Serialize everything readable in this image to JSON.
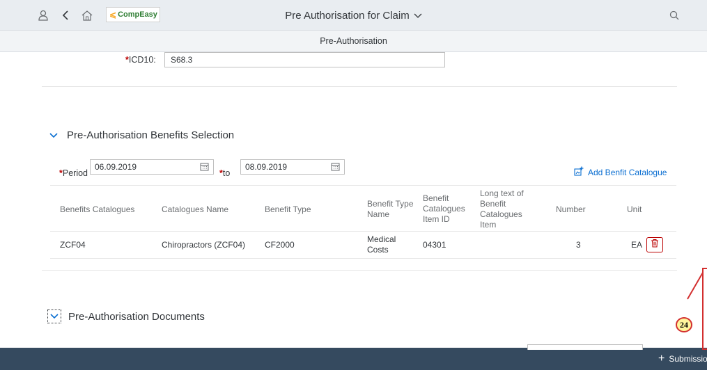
{
  "shell": {
    "logo_text": "CompEasy",
    "logo_mark": "⩽",
    "title": "Pre Authorisation for Claim"
  },
  "subheader": {
    "title": "Pre-Authorisation"
  },
  "icd10": {
    "label": "ICD10:",
    "value": "S68.3"
  },
  "benefits_section": {
    "title": "Pre-Authorisation Benefits Selection",
    "period_label": "Period",
    "period_from": "06.09.2019",
    "to_label": "to",
    "period_to": "08.09.2019",
    "add_link": "Add Benfit Catalogue"
  },
  "table": {
    "headers": [
      "Benefits Catalogues",
      "Catalogues Name",
      "Benefit Type",
      "Benefit Type Name",
      "Benefit Catalogues Item ID",
      "Long text of Benefit Catalogues Item",
      "Number",
      "Unit"
    ],
    "rows": [
      {
        "catalogue": "ZCF04",
        "name": "Chiropractors (ZCF04)",
        "type": "CF2000",
        "type_name": "Medical Costs",
        "item_id": "04301",
        "long_text": "",
        "number": "3",
        "unit": "EA"
      }
    ]
  },
  "documents_section": {
    "title": "Pre-Authorisation Documents"
  },
  "footer": {
    "submission_label": "Submissio"
  },
  "annotation": {
    "badge": "24"
  },
  "colors": {
    "shell_bg": "#e9edf1",
    "footer_bg": "#354a5f",
    "required": "#bb0000",
    "link": "#0a6ed1"
  },
  "icons": [
    "person-icon",
    "back-icon",
    "home-icon",
    "search-icon",
    "chevron-down-icon",
    "calendar-icon",
    "add-catalogue-icon",
    "delete-icon",
    "plus-icon"
  ]
}
